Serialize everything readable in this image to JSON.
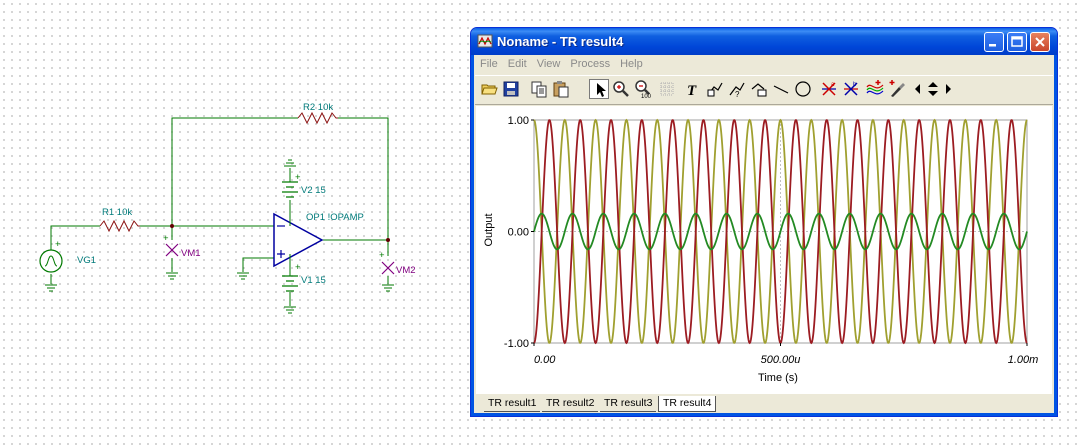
{
  "schematic": {
    "labels": {
      "r2": "R2 10k",
      "r1": "R1 10k",
      "v2": "V2 15",
      "op1": "OP1 !OPAMP",
      "vm1": "VM1",
      "vg1": "VG1",
      "v1": "V1 15",
      "vm2": "VM2"
    },
    "colors": {
      "wire": "#007a00",
      "component": "#007a7a",
      "opamp": "#0000a0",
      "meter": "#800080"
    }
  },
  "window": {
    "title": "Noname - TR result4",
    "menu": [
      "File",
      "Edit",
      "View",
      "Process",
      "Help"
    ],
    "toolbar_icons": [
      "open-folder-icon",
      "save-disk-icon",
      "copy-icon",
      "paste-icon",
      "pointer-icon",
      "zoom-in-icon",
      "zoom-100-icon",
      "grid-icon",
      "text-tool-icon",
      "label-tool-1-icon",
      "label-tool-2-icon",
      "label-tool-3-icon",
      "line-tool-icon",
      "circle-tool-icon",
      "cursor-a-icon",
      "cursor-b-icon",
      "curve-style-icon",
      "marker-pen-icon",
      "arrow-left-icon",
      "arrow-updown-icon",
      "arrow-right-icon"
    ],
    "tabs": [
      "TR result1",
      "TR result2",
      "TR result3",
      "TR result4"
    ],
    "active_tab": 3
  },
  "chart_data": {
    "type": "line",
    "xlabel": "Time (s)",
    "ylabel": "Output",
    "xlim": [
      0,
      0.001
    ],
    "ylim": [
      -1,
      1
    ],
    "x_ticks": [
      "0.00",
      "500.00u",
      "1.00m"
    ],
    "y_ticks": [
      "1.00",
      "0.00",
      "-1.00"
    ],
    "grid": true,
    "series": [
      {
        "color": "#a0a030",
        "amplitude": 1.0,
        "frequency_hz": 16000,
        "phase_deg": 90
      },
      {
        "color": "#9c1c22",
        "amplitude": 1.0,
        "frequency_hz": 16000,
        "phase_deg": -90
      },
      {
        "color": "#238a23",
        "amplitude": 0.16,
        "frequency_hz": 16000,
        "phase_deg": 0
      }
    ]
  }
}
